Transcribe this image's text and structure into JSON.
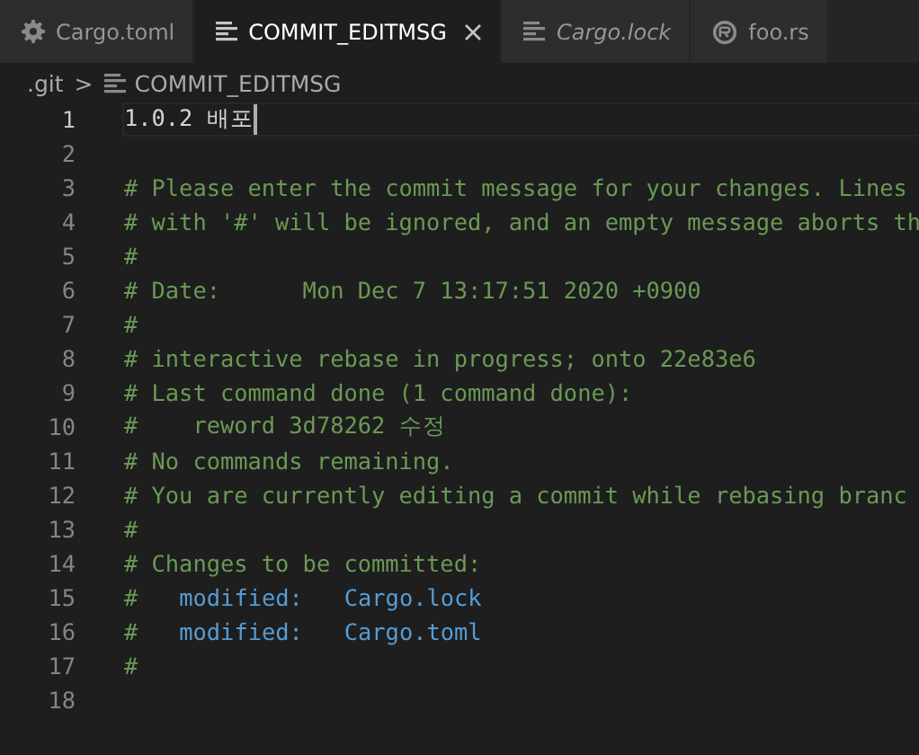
{
  "tabs": [
    {
      "label": "Cargo.toml",
      "kind": "settings",
      "selected": false,
      "preview": false
    },
    {
      "label": "COMMIT_EDITMSG",
      "kind": "text",
      "selected": true,
      "preview": false
    },
    {
      "label": "Cargo.lock",
      "kind": "text",
      "selected": false,
      "preview": true
    },
    {
      "label": "foo.rs",
      "kind": "rust",
      "selected": false,
      "preview": false
    }
  ],
  "breadcrumbs": [
    {
      "label": ".git",
      "kind": "folder"
    },
    {
      "label": "COMMIT_EDITMSG",
      "kind": "text"
    }
  ],
  "breadcrumb_separator": ">",
  "editor": {
    "lines": [
      {
        "number": "1",
        "current": true,
        "segments": [
          {
            "kind": "plain",
            "text": "1.0.2 배포"
          }
        ]
      },
      {
        "number": "2",
        "current": false
      },
      {
        "number": "3",
        "current": false,
        "segments": [
          {
            "kind": "comment",
            "text": "# Please enter the commit message for your changes. Lines"
          }
        ]
      },
      {
        "number": "4",
        "current": false,
        "segments": [
          {
            "kind": "comment",
            "text": "# with '#' will be ignored, and an empty message aborts th"
          }
        ]
      },
      {
        "number": "5",
        "current": false,
        "segments": [
          {
            "kind": "comment",
            "text": "#"
          }
        ]
      },
      {
        "number": "6",
        "current": false,
        "segments": [
          {
            "kind": "comment",
            "text": "# Date:      Mon Dec 7 13:17:51 2020 +0900"
          }
        ]
      },
      {
        "number": "7",
        "current": false,
        "segments": [
          {
            "kind": "comment",
            "text": "#"
          }
        ]
      },
      {
        "number": "8",
        "current": false,
        "segments": [
          {
            "kind": "comment",
            "text": "# interactive rebase in progress; onto 22e83e6"
          }
        ]
      },
      {
        "number": "9",
        "current": false,
        "segments": [
          {
            "kind": "comment",
            "text": "# Last command done (1 command done):"
          }
        ]
      },
      {
        "number": "10",
        "current": false,
        "segments": [
          {
            "kind": "comment",
            "text": "#    reword 3d78262 수정"
          }
        ]
      },
      {
        "number": "11",
        "current": false,
        "segments": [
          {
            "kind": "comment",
            "text": "# No commands remaining."
          }
        ]
      },
      {
        "number": "12",
        "current": false,
        "segments": [
          {
            "kind": "comment",
            "text": "# You are currently editing a commit while rebasing branc"
          }
        ]
      },
      {
        "number": "13",
        "current": false,
        "segments": [
          {
            "kind": "comment",
            "text": "#"
          }
        ]
      },
      {
        "number": "14",
        "current": false,
        "segments": [
          {
            "kind": "comment",
            "text": "# Changes to be committed:"
          }
        ]
      },
      {
        "number": "15",
        "current": false,
        "segments": [
          {
            "kind": "comment",
            "text": "#"
          },
          {
            "kind": "keyword",
            "text": "modified:"
          },
          {
            "kind": "keyword",
            "text": "Cargo.lock"
          }
        ]
      },
      {
        "number": "16",
        "current": false,
        "segments": [
          {
            "kind": "comment",
            "text": "#"
          },
          {
            "kind": "keyword",
            "text": "modified:"
          },
          {
            "kind": "keyword",
            "text": "Cargo.toml"
          }
        ]
      },
      {
        "number": "17",
        "current": false,
        "segments": [
          {
            "kind": "comment",
            "text": "#"
          }
        ]
      },
      {
        "number": "18",
        "current": false
      }
    ]
  }
}
